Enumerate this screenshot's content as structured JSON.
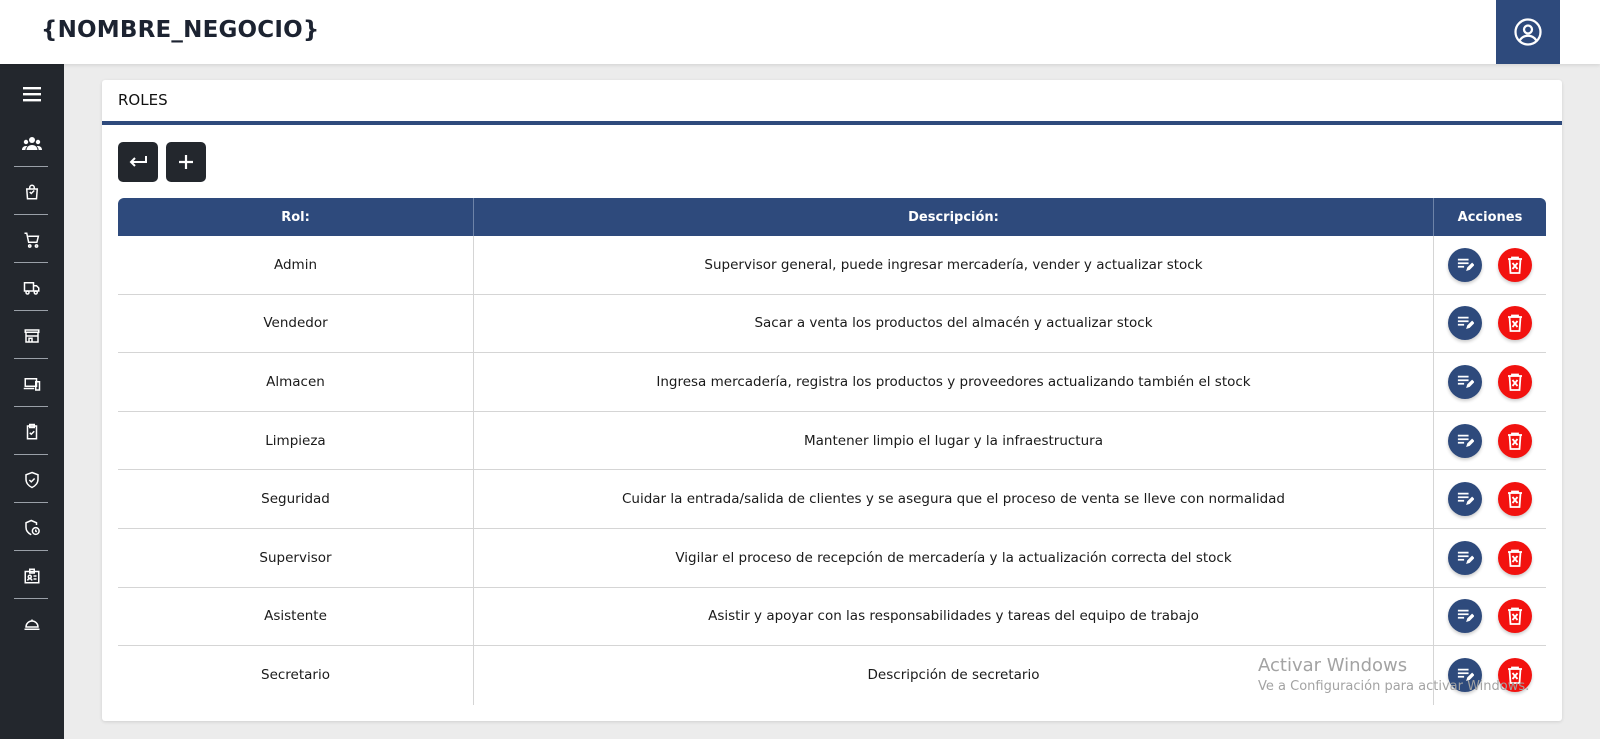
{
  "header": {
    "brand": "{NOMBRE_NEGOCIO}",
    "user_icon": "user-circle-icon"
  },
  "sidebar": {
    "items": [
      {
        "icon": "menu-icon"
      },
      {
        "icon": "users-icon"
      },
      {
        "icon": "shopping-bag-icon"
      },
      {
        "icon": "shopping-cart-icon"
      },
      {
        "icon": "truck-icon"
      },
      {
        "icon": "store-icon"
      },
      {
        "icon": "devices-icon"
      },
      {
        "icon": "clipboard-check-icon"
      },
      {
        "icon": "shield-check-icon"
      },
      {
        "icon": "shield-clock-icon"
      },
      {
        "icon": "id-badge-icon"
      },
      {
        "icon": "bell-service-icon"
      }
    ]
  },
  "panel": {
    "title": "ROLES",
    "back_icon": "return-arrow-icon",
    "add_icon": "plus-icon"
  },
  "table": {
    "headers": {
      "rol": "Rol:",
      "descripcion": "Descripción:",
      "acciones": "Acciones"
    },
    "rows": [
      {
        "rol": "Admin",
        "descripcion": "Supervisor general, puede ingresar mercadería, vender y actualizar stock"
      },
      {
        "rol": "Vendedor",
        "descripcion": "Sacar a venta los productos del almacén y actualizar stock"
      },
      {
        "rol": "Almacen",
        "descripcion": "Ingresa mercadería, registra los productos y proveedores actualizando también el stock"
      },
      {
        "rol": "Limpieza",
        "descripcion": "Mantener limpio el lugar y la infraestructura"
      },
      {
        "rol": "Seguridad",
        "descripcion": "Cuidar la entrada/salida de clientes y se asegura que el proceso de venta se lleve con normalidad"
      },
      {
        "rol": "Supervisor",
        "descripcion": "Vigilar el proceso de recepción de mercadería y la actualización correcta del stock"
      },
      {
        "rol": "Asistente",
        "descripcion": "Asistir y apoyar con las responsabilidades y tareas del equipo de trabajo"
      },
      {
        "rol": "Secretario",
        "descripcion": "Descripción de secretario"
      }
    ],
    "edit_icon": "edit-list-icon",
    "delete_icon": "delete-icon"
  },
  "watermark": {
    "line1": "Activar Windows",
    "line2": "Ve a Configuración para activar Windows."
  },
  "colors": {
    "primary": "#2e4a7c",
    "dark": "#23272d",
    "danger": "#f2120f"
  }
}
